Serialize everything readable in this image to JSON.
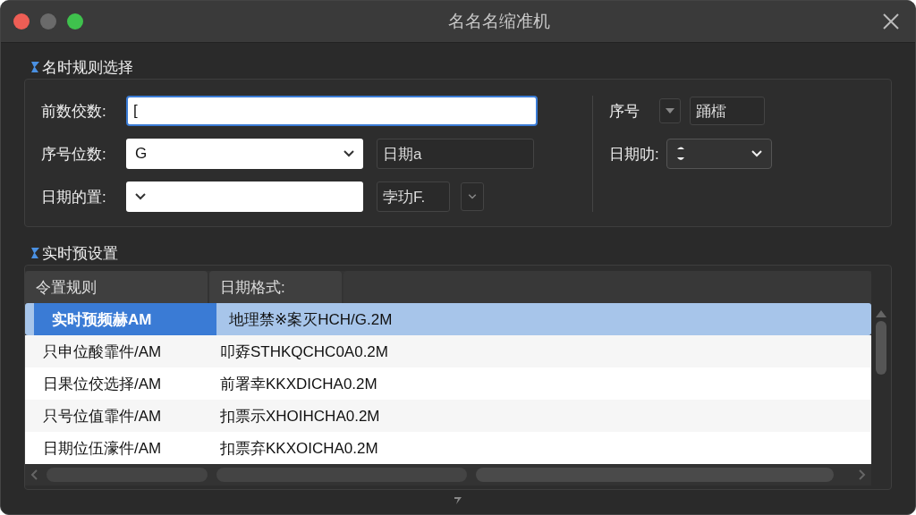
{
  "window": {
    "title": "名名名缩准机"
  },
  "naming_rules": {
    "title": "名时规则选择",
    "prefix": {
      "label": "前数佼数:",
      "value": "[",
      "focused": true
    },
    "digits": {
      "label": "序号位数:",
      "value": "G",
      "side_value": "日期a"
    },
    "date_position": {
      "label": "日期的置:",
      "side_value": "孛玏F."
    },
    "serial": {
      "label": "序号",
      "value": "踊檑"
    },
    "date_format": {
      "label": "日期叻:"
    }
  },
  "presets": {
    "title": "实时预设置",
    "columns": [
      "令置规则",
      "日期格式:"
    ],
    "rows": [
      {
        "cells": [
          "实时预频赫AM",
          "地理禁※案灭HCH/G.2M"
        ],
        "selected": true
      },
      {
        "cells": [
          "只申位酸霏件/AM",
          "叩孬STHKQCHC0A0.2M"
        ],
        "selected": false
      },
      {
        "cells": [
          "日果位佼选择/AM",
          "前署幸KKXDICHA0.2M"
        ],
        "selected": false
      },
      {
        "cells": [
          "只号位值霏件/AM",
          "扣票示XHOIHCHA0.2M"
        ],
        "selected": false
      },
      {
        "cells": [
          "日期位伍濠件/AM",
          "扣票弃KKXOICHA0.2M"
        ],
        "selected": false
      }
    ]
  }
}
